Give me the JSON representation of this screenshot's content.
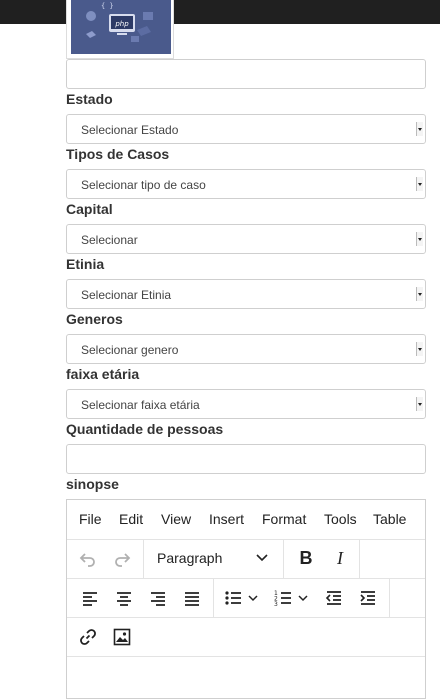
{
  "form": {
    "estado": {
      "label": "Estado",
      "selected": "Selecionar Estado"
    },
    "tipos_casos": {
      "label": "Tipos de Casos",
      "selected": "Selecionar tipo de caso"
    },
    "capital": {
      "label": "Capital",
      "selected": "Selecionar"
    },
    "etinia": {
      "label": "Etinia",
      "selected": "Selecionar Etinia"
    },
    "generos": {
      "label": "Generos",
      "selected": "Selecionar genero"
    },
    "faixa_etaria": {
      "label": "faixa etária",
      "selected": "Selecionar faixa etária"
    },
    "quantidade": {
      "label": "Quantidade de pessoas",
      "value": ""
    },
    "sinopse": {
      "label": "sinopse"
    },
    "top_input_value": ""
  },
  "editor": {
    "menu": [
      "File",
      "Edit",
      "View",
      "Insert",
      "Format",
      "Tools",
      "Table"
    ],
    "block_format": "Paragraph",
    "bold_label": "B",
    "italic_label": "I"
  },
  "thumbnail": {
    "badge_text": "php"
  },
  "colors": {
    "topbar": "#202020",
    "thumbnail_bg": "#4a5a8c"
  }
}
